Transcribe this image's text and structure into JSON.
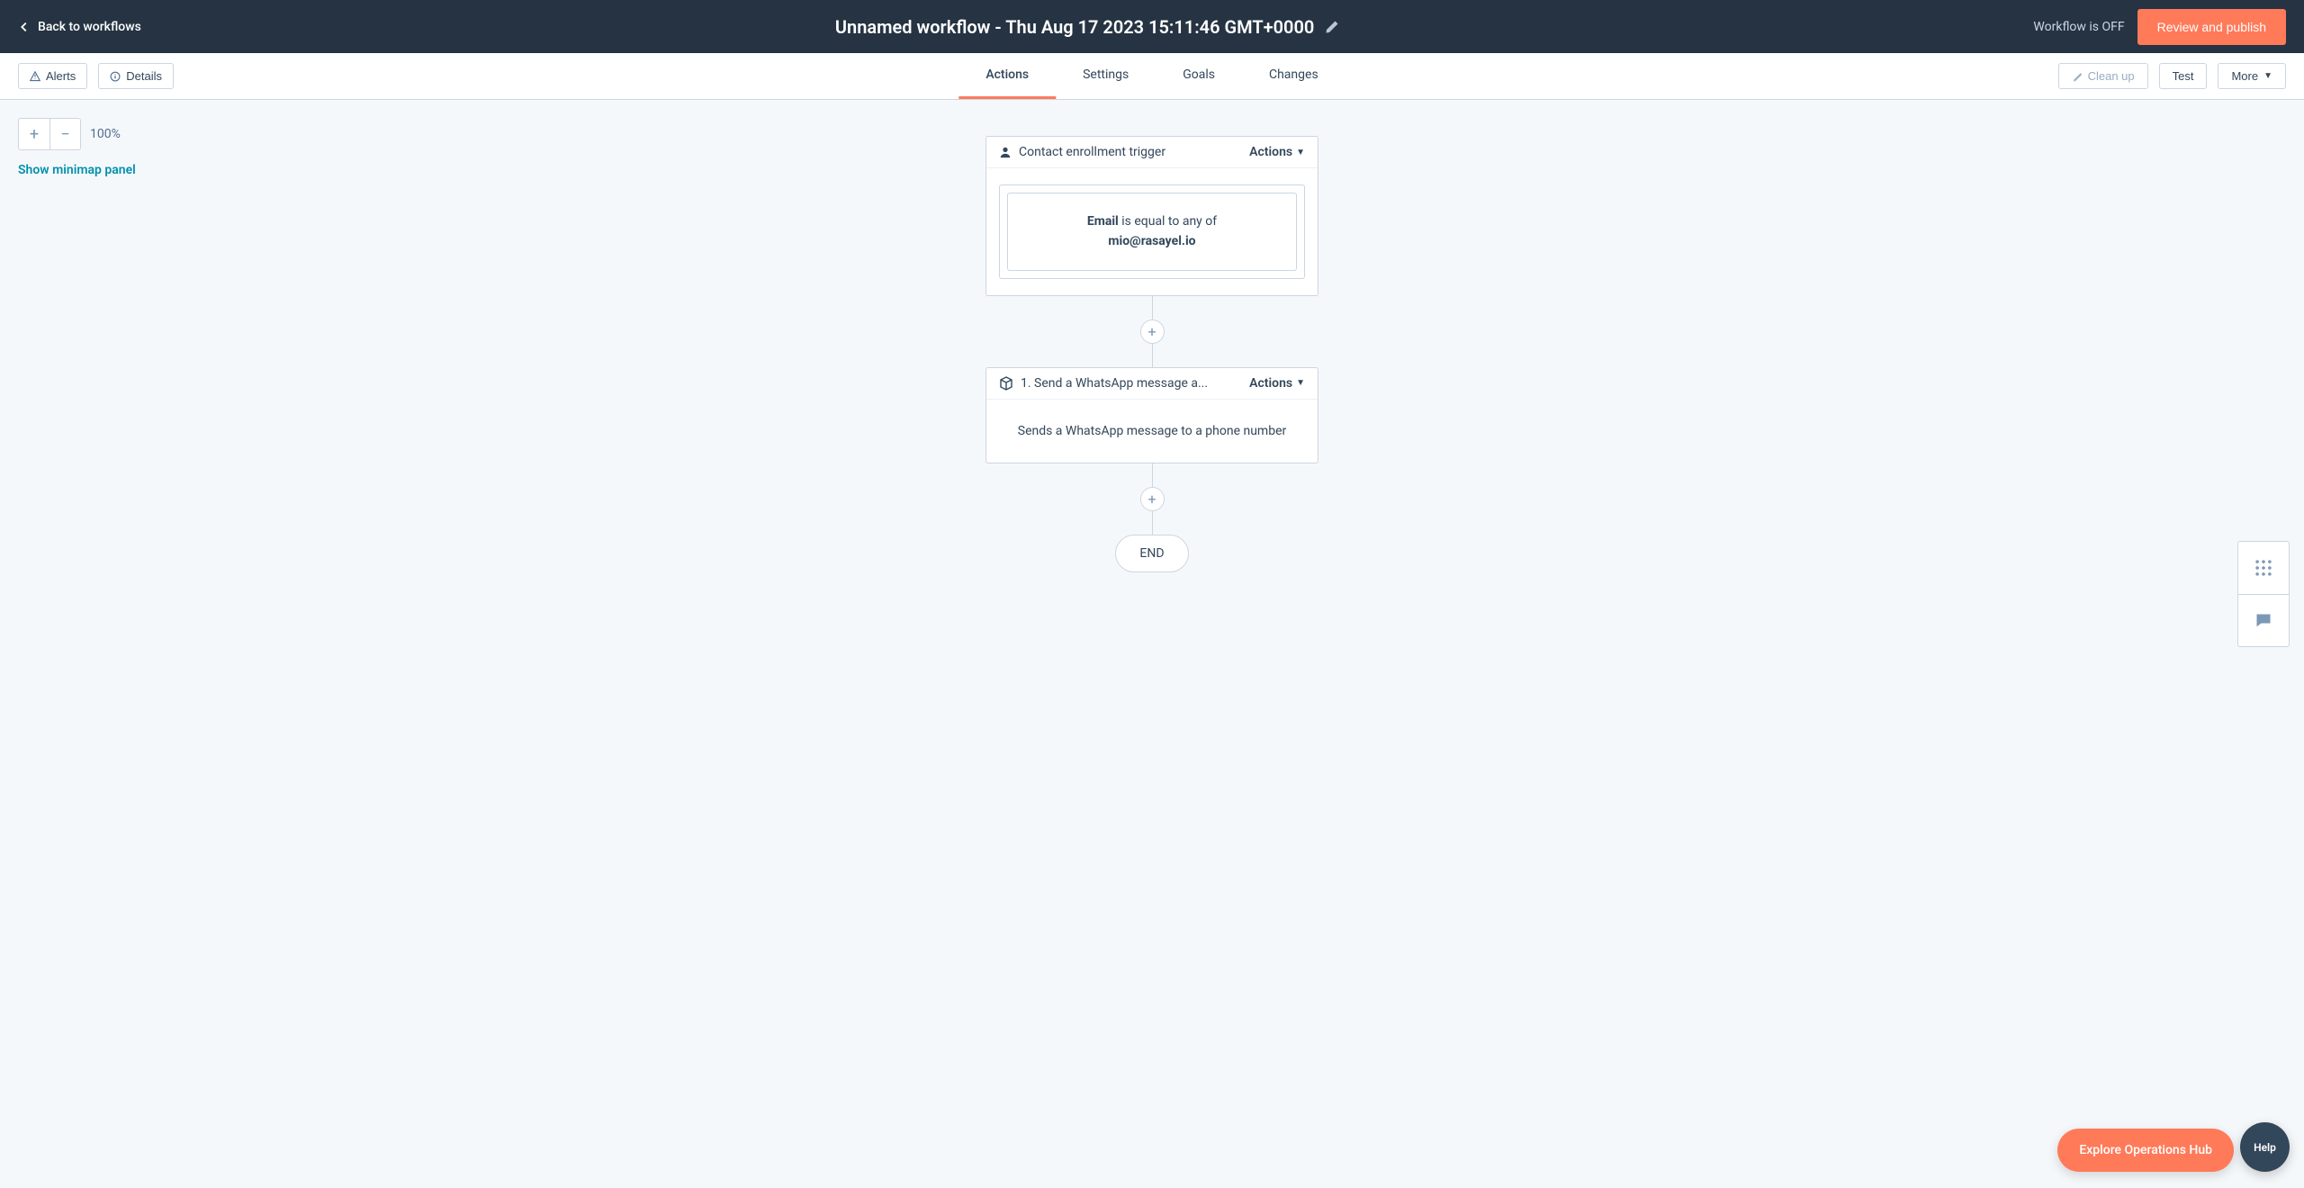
{
  "header": {
    "back_label": "Back to workflows",
    "title": "Unnamed workflow - Thu Aug 17 2023 15:11:46 GMT+0000",
    "status": "Workflow is OFF",
    "publish_label": "Review and publish"
  },
  "toolbar": {
    "alerts": "Alerts",
    "details": "Details",
    "tabs": [
      "Actions",
      "Settings",
      "Goals",
      "Changes"
    ],
    "active_tab": 0,
    "cleanup": "Clean up",
    "test": "Test",
    "more": "More"
  },
  "canvas": {
    "zoom_level": "100%",
    "minimap_label": "Show minimap panel"
  },
  "trigger": {
    "title": "Contact enrollment trigger",
    "actions_label": "Actions",
    "criteria_field": "Email",
    "criteria_operator": " is equal to any of",
    "criteria_value": "mio@rasayel.io"
  },
  "action1": {
    "title": "1. Send a WhatsApp message a...",
    "actions_label": "Actions",
    "description": "Sends a WhatsApp message to a phone number"
  },
  "end_label": "END",
  "footer": {
    "explore": "Explore Operations Hub",
    "help": "Help"
  }
}
